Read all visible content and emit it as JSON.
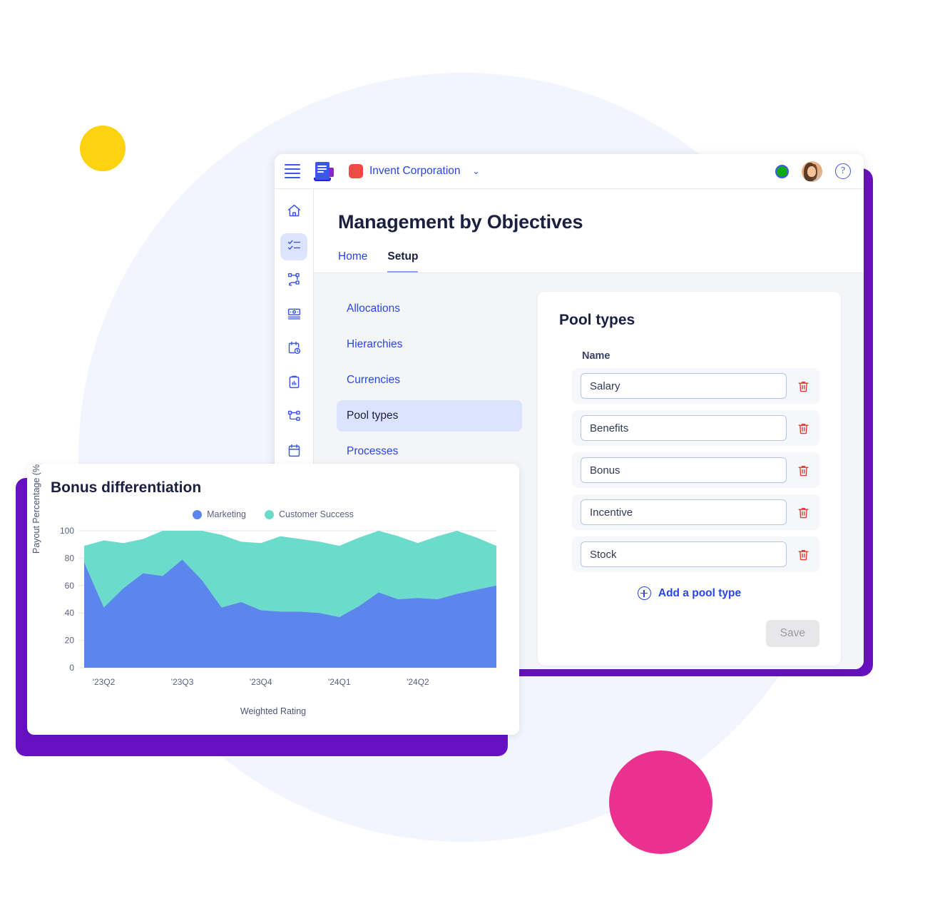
{
  "colors": {
    "accent_blue": "#2746E8",
    "brand_purple": "#6811C2",
    "pink": "#EA3190",
    "yellow": "#FCD211",
    "status_green": "#11A911",
    "danger_red": "#DE3A30",
    "marketing": "#5B87EC",
    "customer_success": "#6BDCCB",
    "page_bg": "#F2F5FE"
  },
  "topbar": {
    "menu_icon": "hamburger-icon",
    "logo_icon": "app-logo-icon",
    "org_name": "Invent Corporation",
    "org_caret": "⌄",
    "status_icon": "status-online-icon",
    "avatar_icon": "user-avatar",
    "help_label": "?"
  },
  "rail": {
    "items": [
      {
        "icon": "home-icon",
        "active": false
      },
      {
        "icon": "tasks-checklist-icon",
        "active": true
      },
      {
        "icon": "org-structure-icon",
        "active": false
      },
      {
        "icon": "payments-card-icon",
        "active": false
      },
      {
        "icon": "calendar-clock-icon",
        "active": false
      },
      {
        "icon": "clipboard-report-icon",
        "active": false
      },
      {
        "icon": "workflow-nodes-icon",
        "active": false
      },
      {
        "icon": "calendar-icon",
        "active": false
      }
    ]
  },
  "page": {
    "title": "Management by Objectives",
    "tabs": [
      {
        "label": "Home",
        "active": false
      },
      {
        "label": "Setup",
        "active": true
      }
    ],
    "nav": [
      {
        "label": "Allocations",
        "active": false
      },
      {
        "label": "Hierarchies",
        "active": false
      },
      {
        "label": "Currencies",
        "active": false
      },
      {
        "label": "Pool types",
        "active": true
      },
      {
        "label": "Processes",
        "active": false
      }
    ]
  },
  "pool_types_card": {
    "title": "Pool types",
    "column_header": "Name",
    "rows": [
      {
        "value": "Salary",
        "delete_icon": "trash-icon"
      },
      {
        "value": "Benefits",
        "delete_icon": "trash-icon"
      },
      {
        "value": "Bonus",
        "delete_icon": "trash-icon"
      },
      {
        "value": "Incentive",
        "delete_icon": "trash-icon"
      },
      {
        "value": "Stock",
        "delete_icon": "trash-icon"
      }
    ],
    "add_label": "Add a pool type",
    "add_icon": "plus-circle-icon",
    "save_label": "Save"
  },
  "chart_card": {
    "title": "Bonus differentiation"
  },
  "chart_data": {
    "type": "area",
    "title": "Bonus differentiation",
    "xlabel": "Weighted Rating",
    "ylabel": "Payout Percentage (%)",
    "ylim": [
      0,
      100
    ],
    "yticks": [
      0,
      20,
      40,
      60,
      80,
      100
    ],
    "grid": true,
    "stacked": true,
    "legend_position": "top-center",
    "x_tick_labels": [
      "'23Q2",
      "'23Q3",
      "'23Q4",
      "'24Q1",
      "'24Q2"
    ],
    "x_tick_indices": [
      1,
      5,
      9,
      13,
      17
    ],
    "x": [
      0,
      1,
      2,
      3,
      4,
      5,
      6,
      7,
      8,
      9,
      10,
      11,
      12,
      13,
      14,
      15,
      16,
      17,
      18,
      19
    ],
    "series": [
      {
        "name": "Marketing",
        "color": "#5B87EC",
        "values": [
          77,
          44,
          58,
          69,
          67,
          79,
          64,
          44,
          48,
          42,
          41,
          41,
          40,
          37,
          45,
          55,
          50,
          51,
          50,
          54,
          57,
          60
        ]
      },
      {
        "name": "Customer Success",
        "color": "#6BDCCB",
        "values": [
          89,
          93,
          91,
          94,
          100,
          100,
          100,
          97,
          92,
          91,
          96,
          94,
          92,
          89,
          95,
          100,
          96,
          91,
          96,
          100,
          95,
          89
        ]
      }
    ]
  }
}
